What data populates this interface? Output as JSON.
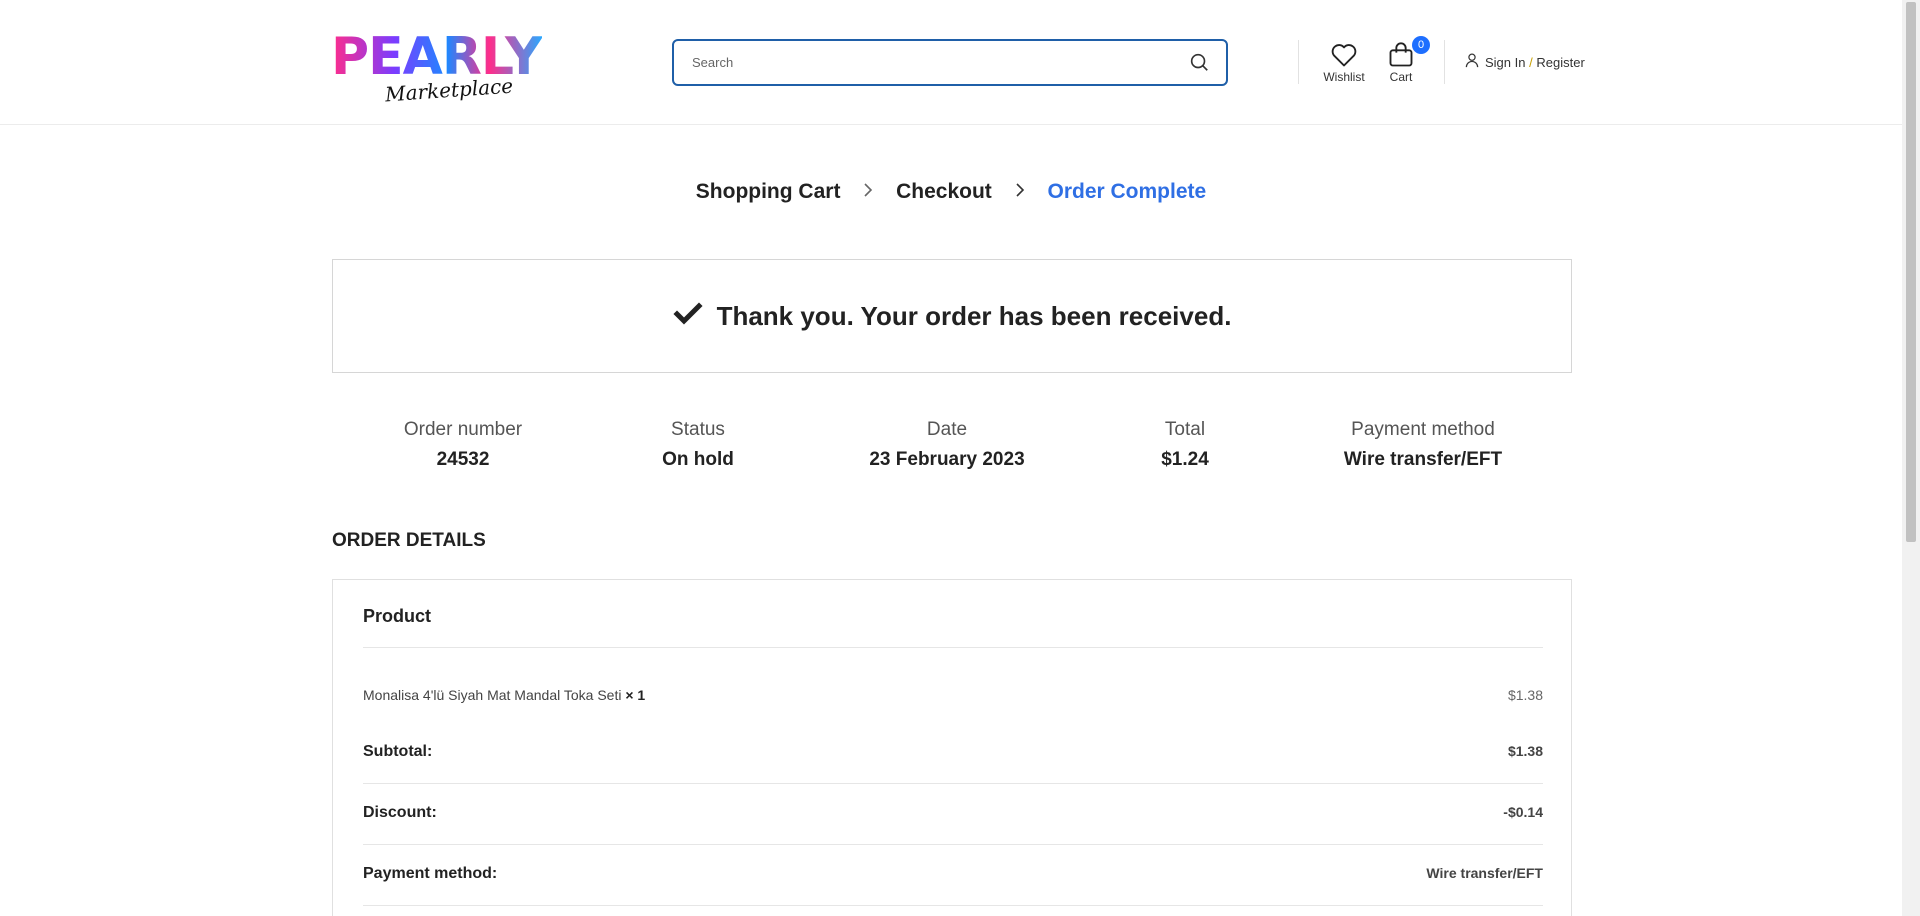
{
  "header": {
    "logo_main": "PEARLY",
    "logo_sub": "Marketplace",
    "search_placeholder": "Search",
    "wishlist_label": "Wishlist",
    "cart_label": "Cart",
    "cart_count": "0",
    "sign_in": "Sign In",
    "separator": "/",
    "register": "Register"
  },
  "steps": {
    "step1": "Shopping Cart",
    "step2": "Checkout",
    "step3": "Order Complete"
  },
  "thanks": {
    "message": "Thank you. Your order has been received."
  },
  "summary": {
    "order_number_label": "Order number",
    "order_number": "24532",
    "status_label": "Status",
    "status": "On hold",
    "date_label": "Date",
    "date": "23 February 2023",
    "total_label": "Total",
    "total": "$1.24",
    "payment_label": "Payment method",
    "payment": "Wire transfer/EFT"
  },
  "order_details": {
    "title": "ORDER DETAILS",
    "product_header": "Product",
    "product_name": "Monalisa 4'lü Siyah Mat Mandal Toka Seti",
    "product_qty": "× 1",
    "product_price": "$1.38",
    "subtotal_label": "Subtotal:",
    "subtotal": "$1.38",
    "discount_label": "Discount:",
    "discount": "-$0.14",
    "payment_label": "Payment method:",
    "payment": "Wire transfer/EFT"
  },
  "colors": {
    "accent": "#2f6fe4",
    "badge": "#1e6fff",
    "search_border": "#1f5fa8"
  }
}
